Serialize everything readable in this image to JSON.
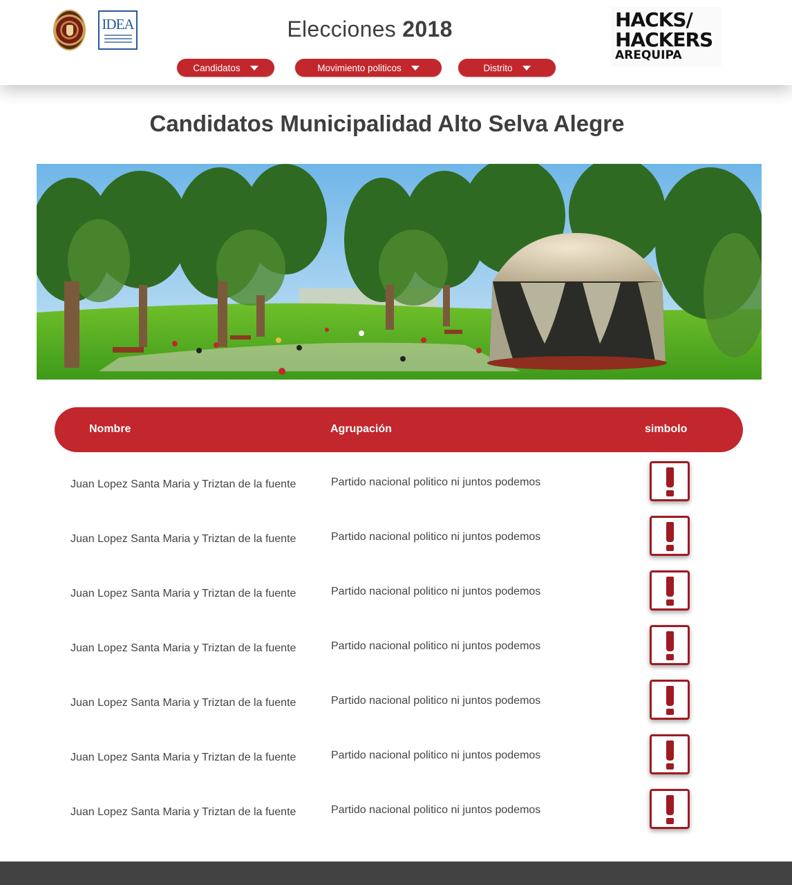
{
  "header": {
    "title_light": "Elecciones",
    "title_bold": "2018",
    "logos": {
      "left_seal": "university-seal-icon",
      "idea_text": "IDEA",
      "hh_line1": "HACKS/",
      "hh_line2": "HACKERS",
      "hh_line3": "AREQUIPA"
    },
    "nav": [
      {
        "label": "Candidatos",
        "icon": "caret-down-icon"
      },
      {
        "label": "Movimiento politicos",
        "icon": "caret-down-icon"
      },
      {
        "label": "Distrito",
        "icon": "caret-down-icon"
      }
    ],
    "accent_color": "#c1272d"
  },
  "main": {
    "title": "Candidatos Municipalidad Alto Selva Alegre",
    "banner": "park-photo",
    "table": {
      "columns": [
        "Nombre",
        "Agrupación",
        "simbolo"
      ],
      "rows": [
        {
          "name": "Juan Lopez Santa Maria y Triztan de la fuente",
          "group": "Partido nacional politico ni juntos podemos",
          "symbol": "exclamation-icon"
        },
        {
          "name": "Juan Lopez Santa Maria y Triztan de la fuente",
          "group": "Partido nacional politico ni juntos podemos",
          "symbol": "exclamation-icon"
        },
        {
          "name": "Juan Lopez Santa Maria y Triztan de la fuente",
          "group": "Partido nacional politico ni juntos podemos",
          "symbol": "exclamation-icon"
        },
        {
          "name": "Juan Lopez Santa Maria y Triztan de la fuente",
          "group": "Partido nacional politico ni juntos podemos",
          "symbol": "exclamation-icon"
        },
        {
          "name": "Juan Lopez Santa Maria y Triztan de la fuente",
          "group": "Partido nacional politico ni juntos podemos",
          "symbol": "exclamation-icon"
        },
        {
          "name": "Juan Lopez Santa Maria y Triztan de la fuente",
          "group": "Partido nacional politico ni juntos podemos",
          "symbol": "exclamation-icon"
        },
        {
          "name": "Juan Lopez Santa Maria y Triztan de la fuente",
          "group": "Partido nacional politico ni juntos podemos",
          "symbol": "exclamation-icon"
        }
      ]
    }
  },
  "footer": {
    "color": "#424242"
  }
}
